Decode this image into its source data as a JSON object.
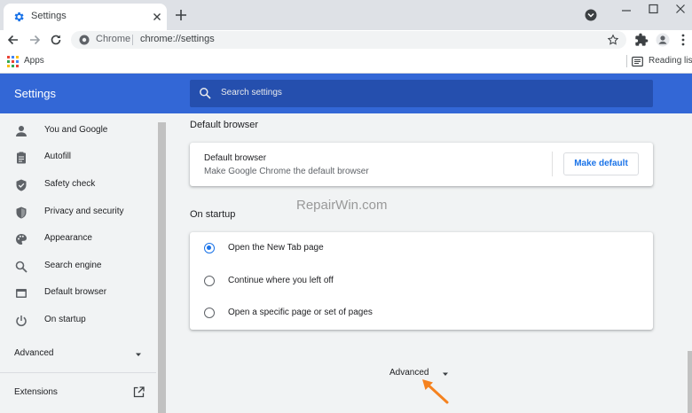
{
  "browser": {
    "tab": {
      "title": "Settings"
    },
    "address_bar": {
      "chip": "Chrome",
      "url": "chrome://settings"
    },
    "bookmarks": {
      "apps_label": "Apps",
      "reading_list_label": "Reading list"
    }
  },
  "settings": {
    "header_title": "Settings",
    "search_placeholder": "Search settings",
    "sidebar": {
      "items": [
        {
          "label": "You and Google",
          "icon": "person-icon"
        },
        {
          "label": "Autofill",
          "icon": "clipboard-icon"
        },
        {
          "label": "Safety check",
          "icon": "shield-check-icon"
        },
        {
          "label": "Privacy and security",
          "icon": "shield-icon"
        },
        {
          "label": "Appearance",
          "icon": "palette-icon"
        },
        {
          "label": "Search engine",
          "icon": "search-icon"
        },
        {
          "label": "Default browser",
          "icon": "browser-icon"
        },
        {
          "label": "On startup",
          "icon": "power-icon"
        }
      ],
      "advanced_label": "Advanced",
      "extensions_label": "Extensions"
    },
    "default_browser": {
      "section_title": "Default browser",
      "row_title": "Default browser",
      "row_subtitle": "Make Google Chrome the default browser",
      "button_label": "Make default"
    },
    "on_startup": {
      "section_title": "On startup",
      "options": [
        {
          "label": "Open the New Tab page",
          "checked": true
        },
        {
          "label": "Continue where you left off",
          "checked": false
        },
        {
          "label": "Open a specific page or set of pages",
          "checked": false
        }
      ]
    },
    "advanced_label": "Advanced",
    "watermark": "RepairWin.com"
  },
  "colors": {
    "header_blue": "#3367d6",
    "search_blue": "#254fae",
    "link_blue": "#1a73e8",
    "annotation_arrow": "#f5821f"
  }
}
